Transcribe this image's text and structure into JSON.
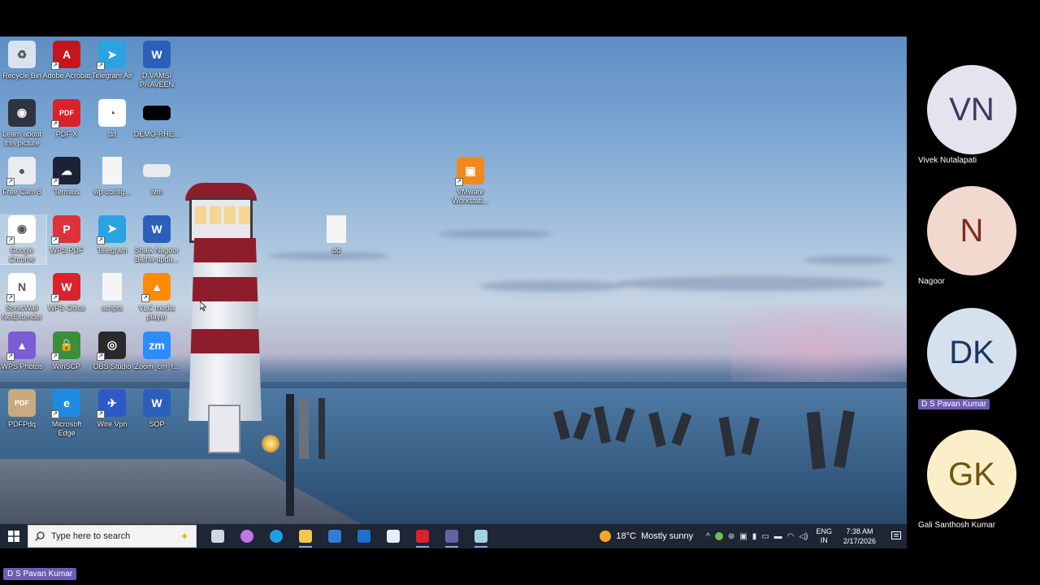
{
  "desktop": {
    "icons": [
      {
        "id": "recycle-bin",
        "label": "Recycle Bin",
        "color": "#d9e3ee",
        "glyph": "♻",
        "shortcut": false
      },
      {
        "id": "adobe-acrobat",
        "label": "Adobe Acrobat",
        "color": "#c4161c",
        "glyph": "A",
        "shortcut": true
      },
      {
        "id": "telegram-air",
        "label": "Telegram Air",
        "color": "#2aa3e0",
        "glyph": "➤",
        "shortcut": true
      },
      {
        "id": "d-vamsi-praveen",
        "label": "D VAMSI PRAVEEN",
        "color": "#2b5fba",
        "glyph": "W",
        "shortcut": false
      },
      {
        "id": "learn-about-picture",
        "label": "Learn about this picture",
        "color": "#2f3440",
        "glyph": "◉",
        "shortcut": false
      },
      {
        "id": "pdf-x",
        "label": "PDF X",
        "color": "#d9222a",
        "glyph": "PDF",
        "shortcut": true
      },
      {
        "id": "dd-image",
        "label": "dd",
        "color": "#ffffff",
        "glyph": "◔",
        "shortcut": false
      },
      {
        "id": "demo-rhe",
        "label": "DEMO-RHE...",
        "color": "#000000",
        "glyph": "",
        "shortcut": false
      },
      {
        "id": "free-cam-8",
        "label": "Free Cam 8",
        "color": "#e9edf2",
        "glyph": "●",
        "shortcut": true
      },
      {
        "id": "termius",
        "label": "Termius",
        "color": "#1c2236",
        "glyph": "☁",
        "shortcut": true
      },
      {
        "id": "wp-config",
        "label": "wp-config...",
        "color": "#f5f5f5",
        "glyph": "",
        "shortcut": false
      },
      {
        "id": "lvm",
        "label": "lvm",
        "color": "#e8eaee",
        "glyph": "",
        "shortcut": false
      },
      {
        "id": "google-chrome",
        "label": "Google Chrome",
        "color": "#ffffff",
        "glyph": "◉",
        "shortcut": true,
        "selected": true
      },
      {
        "id": "wps-pdf",
        "label": "WPS PDF",
        "color": "#e0303a",
        "glyph": "P",
        "shortcut": true
      },
      {
        "id": "telegram",
        "label": "Telegram",
        "color": "#2aa3e0",
        "glyph": "➤",
        "shortcut": true
      },
      {
        "id": "shaik-nagoor",
        "label": "Shaik Nagoor Batha-upda...",
        "color": "#2b5fba",
        "glyph": "W",
        "shortcut": false
      },
      {
        "id": "sonicwall",
        "label": "SonicWall NetExtender",
        "color": "#ffffff",
        "glyph": "N",
        "shortcut": true
      },
      {
        "id": "wps-office",
        "label": "WPS Office",
        "color": "#d9222a",
        "glyph": "W",
        "shortcut": true
      },
      {
        "id": "scripts",
        "label": "scripts",
        "color": "#f5f5f5",
        "glyph": "",
        "shortcut": false
      },
      {
        "id": "vlc",
        "label": "VLC media player",
        "color": "#ff8c00",
        "glyph": "▲",
        "shortcut": true
      },
      {
        "id": "wps-photos",
        "label": "WPS Photos",
        "color": "#7b5bd6",
        "glyph": "▲",
        "shortcut": true
      },
      {
        "id": "winscp",
        "label": "WinSCP",
        "color": "#3c8e3c",
        "glyph": "🔒",
        "shortcut": true
      },
      {
        "id": "obs-studio",
        "label": "OBS Studio",
        "color": "#2a2a2a",
        "glyph": "◎",
        "shortcut": true
      },
      {
        "id": "zoom",
        "label": "Zoom_cm_f...",
        "color": "#2d8cff",
        "glyph": "zm",
        "shortcut": false
      },
      {
        "id": "pdfpdq",
        "label": "PDFPdq",
        "color": "#c9a97e",
        "glyph": "PDF",
        "shortcut": false
      },
      {
        "id": "microsoft-edge",
        "label": "Microsoft Edge",
        "color": "#1f8be0",
        "glyph": "e",
        "shortcut": true
      },
      {
        "id": "wire-vpn",
        "label": "Wire Vpn",
        "color": "#2d59c8",
        "glyph": "✈",
        "shortcut": true
      },
      {
        "id": "sop",
        "label": "SOP",
        "color": "#2b5fba",
        "glyph": "W",
        "shortcut": false
      }
    ],
    "floating_icons": [
      {
        "id": "vmware",
        "label": "VMware Workstati...",
        "color": "#f08a1d",
        "glyph": "▣",
        "shortcut": true
      },
      {
        "id": "dd-file",
        "label": "dd",
        "color": "#f5f5f5",
        "glyph": "",
        "shortcut": false
      }
    ]
  },
  "taskbar": {
    "search_placeholder": "Type here to search",
    "apps": [
      {
        "id": "task-view",
        "color": "#cfd6e3",
        "running": false
      },
      {
        "id": "copilot",
        "color": "#c276e6",
        "running": false
      },
      {
        "id": "edge",
        "color": "#1fa0e0",
        "running": false
      },
      {
        "id": "file-explorer",
        "color": "#f2c94c",
        "running": true
      },
      {
        "id": "store",
        "color": "#2f7fd8",
        "running": false
      },
      {
        "id": "outlook",
        "color": "#1e6fd1",
        "running": false
      },
      {
        "id": "snipping-tool",
        "color": "#e7edf5",
        "running": false
      },
      {
        "id": "wps",
        "color": "#d9222a",
        "running": true
      },
      {
        "id": "teams",
        "color": "#6264a7",
        "running": true
      },
      {
        "id": "notepad",
        "color": "#9fd2e6",
        "running": true
      }
    ],
    "weather": {
      "temp": "18°C",
      "desc": "Mostly sunny"
    },
    "lang": {
      "top": "ENG",
      "bottom": "IN"
    },
    "clock": {
      "time": "7:38 AM",
      "date": "2/17/2026"
    }
  },
  "participants": [
    {
      "initials": "VN",
      "name": "Vivek Nutalapati",
      "bg": "#e6e3ef",
      "fg": "#3b3866",
      "highlight": false
    },
    {
      "initials": "N",
      "name": "Nagoor",
      "bg": "#f2d9cf",
      "fg": "#7a2e1a",
      "highlight": false
    },
    {
      "initials": "DK",
      "name": "D S Pavan  Kumar",
      "bg": "#d6e1ee",
      "fg": "#1b3560",
      "highlight": true
    },
    {
      "initials": "GK",
      "name": "Gali Santhosh Kumar",
      "bg": "#fbefc9",
      "fg": "#6c5410",
      "highlight": false
    }
  ],
  "presenter_label": "D S Pavan  Kumar"
}
